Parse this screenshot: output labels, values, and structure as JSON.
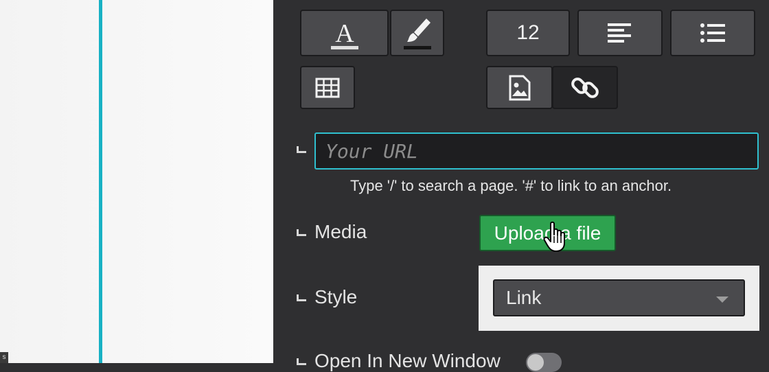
{
  "toolbar": {
    "font_size_value": "12"
  },
  "url_field": {
    "placeholder": "Your URL",
    "value": "",
    "hint": "Type '/' to search a page. '#' to link to an anchor."
  },
  "media": {
    "label": "Media",
    "upload_button": "Upload a file"
  },
  "style": {
    "label": "Style",
    "selected": "Link"
  },
  "open_new_window": {
    "label": "Open In New Window",
    "enabled": false
  },
  "colors": {
    "accent_cyan": "#2fc0cf",
    "upload_green": "#2ea24f",
    "panel_bg": "#2f2f31"
  }
}
